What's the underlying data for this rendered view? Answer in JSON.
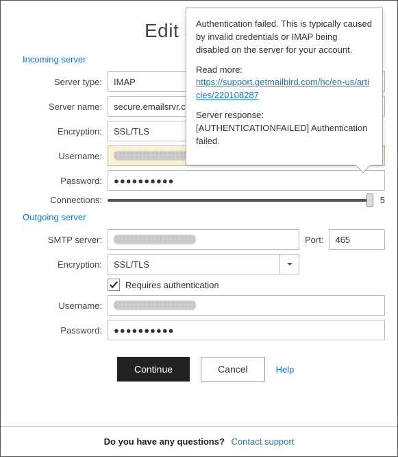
{
  "title": "Edit settings",
  "sections": {
    "incoming": "Incoming server",
    "outgoing": "Outgoing server"
  },
  "labels": {
    "server_type": "Server type:",
    "server_name": "Server name:",
    "encryption": "Encryption:",
    "username": "Username:",
    "password": "Password:",
    "connections": "Connections:",
    "smtp_server": "SMTP server:",
    "port": "Port:",
    "requires_auth": "Requires authentication"
  },
  "incoming": {
    "server_type": "IMAP",
    "server_name": "secure.emailsrvr.com",
    "encryption": "SSL/TLS",
    "username_masked": true,
    "password_display": "●●●●●●●●●●",
    "connections_value": "5"
  },
  "outgoing": {
    "smtp_server_masked": true,
    "port": "465",
    "encryption": "SSL/TLS",
    "requires_auth_checked": true,
    "username_masked": true,
    "password_display": "●●●●●●●●●●"
  },
  "actions": {
    "continue": "Continue",
    "cancel": "Cancel",
    "help": "Help"
  },
  "footer": {
    "question": "Do you have any questions?",
    "contact": "Contact support"
  },
  "tooltip": {
    "line1": "Authentication failed. This is typically caused by invalid credentials or IMAP being disabled on the server for your account.",
    "readmore_label": "Read more:",
    "readmore_link": "https://support.getmailbird.com/hc/en-us/articles/220108287",
    "server_response_label": "Server response:",
    "server_response": "[AUTHENTICATIONFAILED] Authentication failed."
  }
}
